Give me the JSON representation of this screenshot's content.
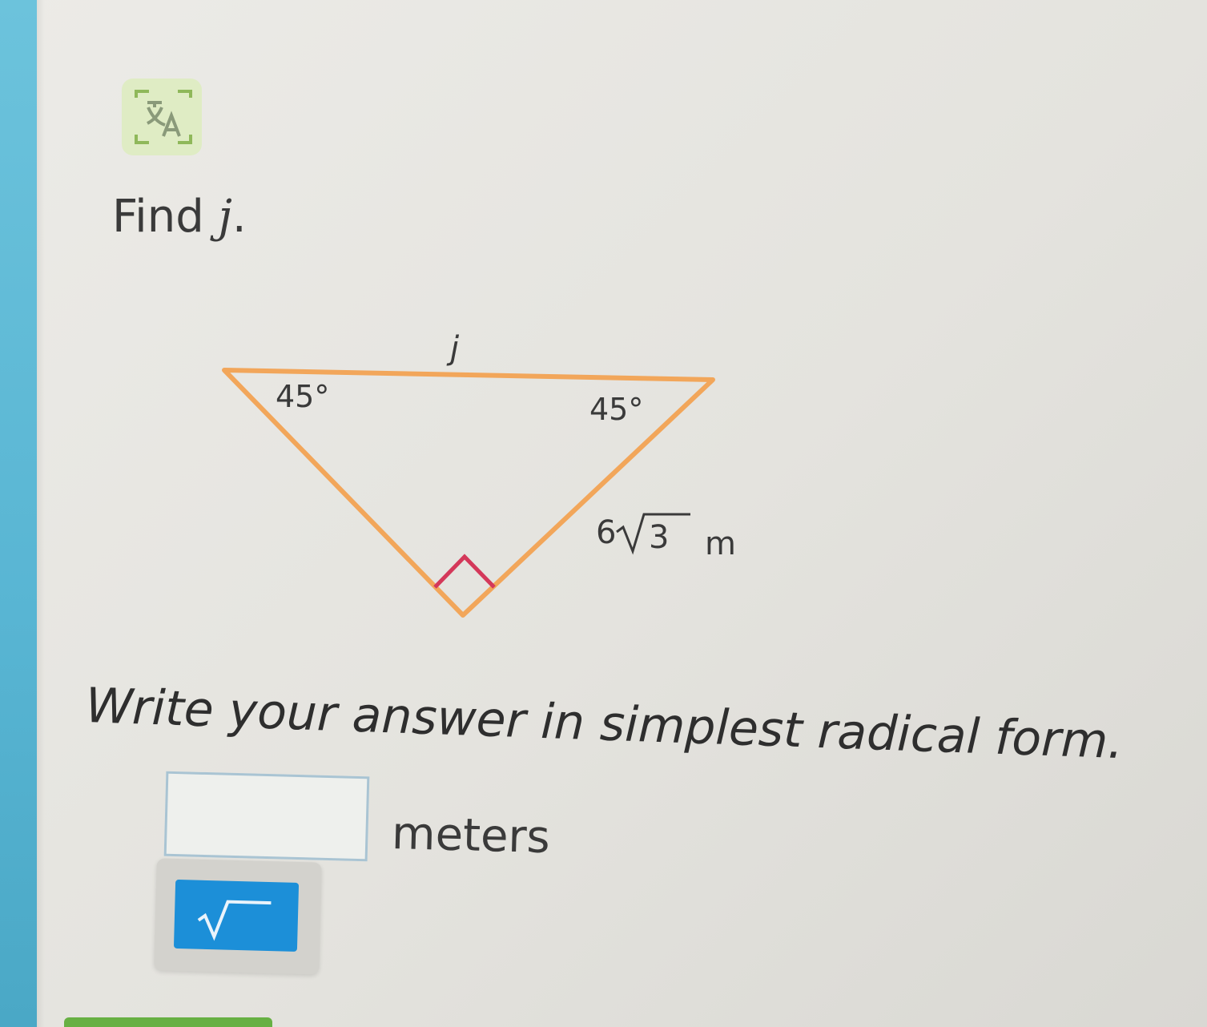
{
  "toolbar": {
    "translate_icon": "translate-icon"
  },
  "question": {
    "prefix": "Find ",
    "variable": "j",
    "suffix": "."
  },
  "diagram": {
    "side_label_top": "j",
    "angle_left": "45°",
    "angle_right": "45°",
    "side_coefficient": "6",
    "side_radicand": "3",
    "side_unit": "m",
    "triangle_color": "#f2a65a",
    "right_angle_color": "#d4385a"
  },
  "instruction": "Write your answer in simplest radical form.",
  "answer": {
    "value": "",
    "unit": "meters"
  },
  "math_toolbar": {
    "sqrt_icon": "square-root-icon",
    "button_color": "#1c8fd8"
  }
}
